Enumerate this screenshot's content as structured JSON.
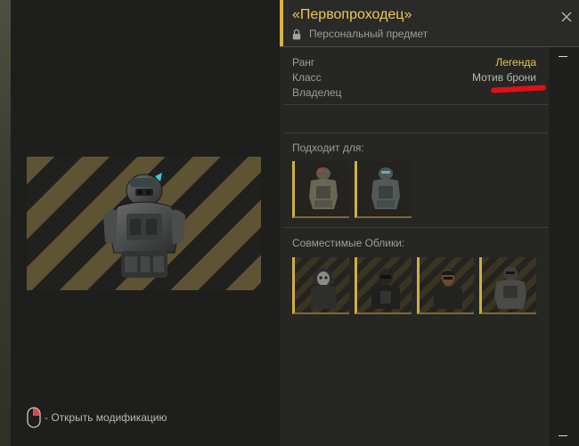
{
  "left": {
    "hint_text": "- Открыть модификацию",
    "mouse_icon": "mouse-icon"
  },
  "item": {
    "title": "«Первопроходец»",
    "subtitle": "Персональный предмет",
    "lock_icon": "lock-icon",
    "close_icon": "close-icon"
  },
  "stats": [
    {
      "label": "Ранг",
      "value": "Легенда"
    },
    {
      "label": "Класс",
      "value": "Мотив брони"
    },
    {
      "label": "Владелец",
      "value": ""
    }
  ],
  "suitable": {
    "title": "Подходит для:",
    "items": [
      "armor-variant-1",
      "armor-variant-2"
    ]
  },
  "skins": {
    "title": "Совместимые Облики:",
    "items": [
      "skin-1",
      "skin-2",
      "skin-3",
      "skin-4"
    ]
  },
  "colors": {
    "accent": "#d8b43e",
    "title": "#ecca5a",
    "rank": "#e8c44a",
    "redaction": "#e01015"
  }
}
